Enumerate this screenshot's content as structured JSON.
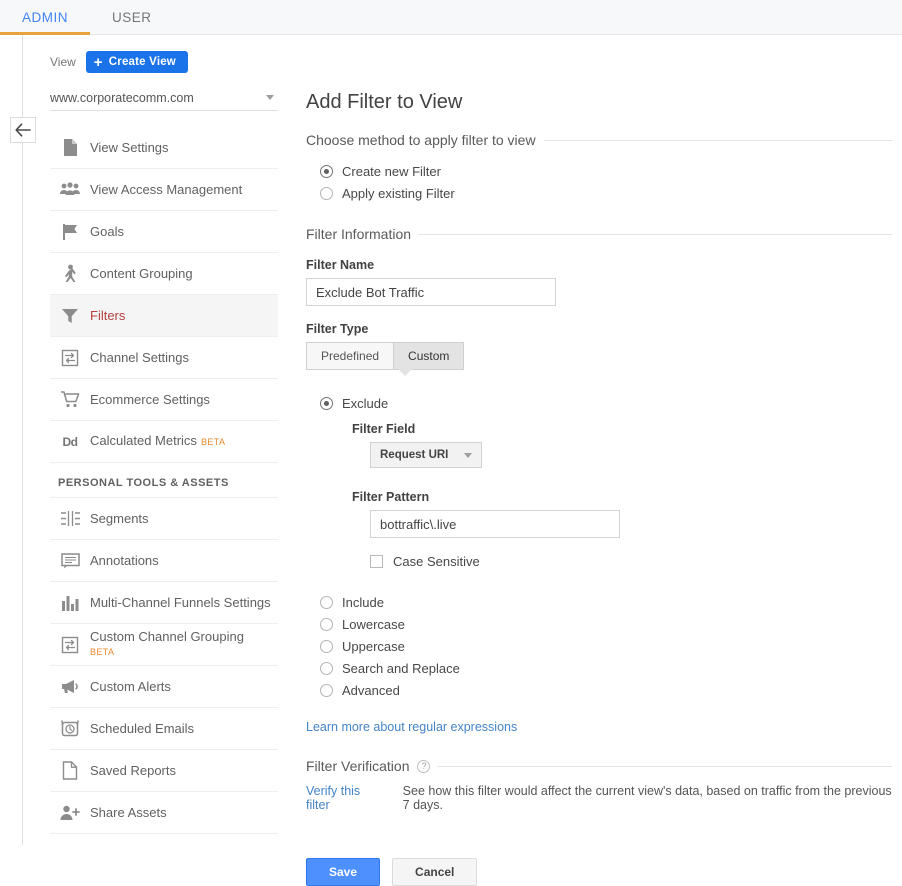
{
  "tabs": [
    {
      "label": "ADMIN",
      "active": true
    },
    {
      "label": "USER",
      "active": false
    }
  ],
  "back_button": {
    "icon": "arrow-left-icon"
  },
  "view_panel": {
    "label": "View",
    "create_button": "Create View",
    "selected_view": "www.corporatecomm.com"
  },
  "sidebar": {
    "items": [
      {
        "label": "View Settings",
        "icon": "document-icon",
        "active": false
      },
      {
        "label": "View Access Management",
        "icon": "people-icon",
        "active": false
      },
      {
        "label": "Goals",
        "icon": "flag-icon",
        "active": false
      },
      {
        "label": "Content Grouping",
        "icon": "person-walking-icon",
        "active": false
      },
      {
        "label": "Filters",
        "icon": "funnel-icon",
        "active": true
      },
      {
        "label": "Channel Settings",
        "icon": "channel-icon",
        "active": false
      },
      {
        "label": "Ecommerce Settings",
        "icon": "cart-icon",
        "active": false
      },
      {
        "label": "Calculated Metrics",
        "icon": "dd-icon",
        "badge": "BETA",
        "active": false
      }
    ],
    "section_title": "PERSONAL TOOLS & ASSETS",
    "personal_items": [
      {
        "label": "Segments",
        "icon": "segments-icon",
        "active": false
      },
      {
        "label": "Annotations",
        "icon": "comment-icon",
        "active": false
      },
      {
        "label": "Multi-Channel Funnels Settings",
        "icon": "bar-chart-icon",
        "active": false
      },
      {
        "label": "Custom Channel Grouping",
        "icon": "channel-icon",
        "badge": "BETA",
        "active": false
      },
      {
        "label": "Custom Alerts",
        "icon": "megaphone-icon",
        "active": false
      },
      {
        "label": "Scheduled Emails",
        "icon": "alarm-clock-icon",
        "active": false
      },
      {
        "label": "Saved Reports",
        "icon": "document-icon",
        "active": false
      },
      {
        "label": "Share Assets",
        "icon": "person-add-icon",
        "active": false
      }
    ]
  },
  "main": {
    "title": "Add Filter to View",
    "method_section": {
      "heading": "Choose method to apply filter to view",
      "options": [
        {
          "label": "Create new Filter",
          "checked": true
        },
        {
          "label": "Apply existing Filter",
          "checked": false
        }
      ]
    },
    "filter_info": {
      "heading": "Filter Information",
      "name_label": "Filter Name",
      "name_value": "Exclude Bot Traffic",
      "name_placeholder": "",
      "type_label": "Filter Type",
      "type_tabs": [
        {
          "label": "Predefined",
          "selected": false
        },
        {
          "label": "Custom",
          "selected": true
        }
      ],
      "exclude_option": {
        "label": "Exclude",
        "checked": true
      },
      "field_label": "Filter Field",
      "field_value": "Request URI",
      "pattern_label": "Filter Pattern",
      "pattern_value": "bottraffic\\.live",
      "pattern_placeholder": "",
      "case_sensitive": {
        "label": "Case Sensitive",
        "checked": false
      },
      "other_options": [
        {
          "label": "Include",
          "checked": false
        },
        {
          "label": "Lowercase",
          "checked": false
        },
        {
          "label": "Uppercase",
          "checked": false
        },
        {
          "label": "Search and Replace",
          "checked": false
        },
        {
          "label": "Advanced",
          "checked": false
        }
      ],
      "regex_link": "Learn more about regular expressions"
    },
    "verification": {
      "heading": "Filter Verification",
      "help_icon": "help-icon",
      "verify_link": "Verify this filter",
      "note": "See how this filter would affect the current view's data, based on traffic from the previous 7 days."
    },
    "actions": {
      "save": "Save",
      "cancel": "Cancel"
    }
  },
  "colors": {
    "accent_blue": "#1a73e8",
    "tab_underline": "#e8a33d",
    "active_nav_text": "#b5403f",
    "beta_badge": "#e68a2e",
    "link": "#4484c7",
    "save_button": "#4d90fe"
  }
}
